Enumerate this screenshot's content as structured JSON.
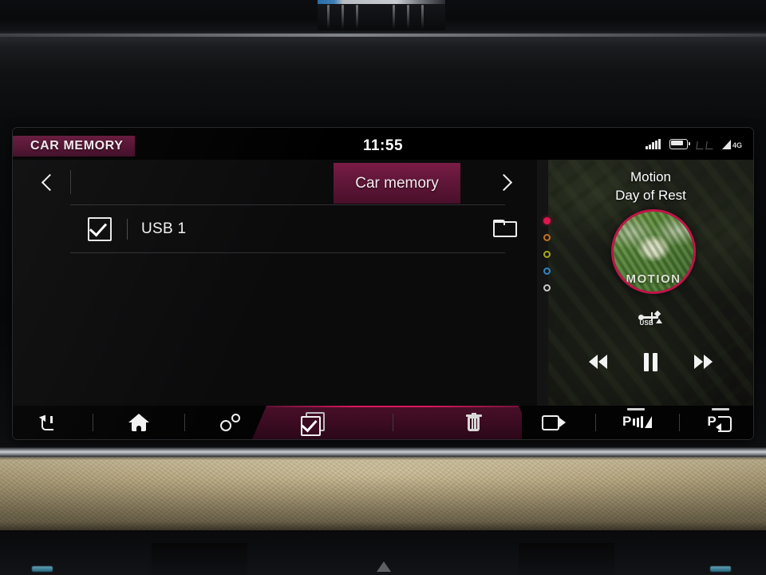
{
  "status_bar": {
    "corner_badge": "CAR MEMORY",
    "clock": "11:55",
    "icons": {
      "signal": "signal-bars-icon",
      "battery": "battery-icon",
      "seat": "seat-sensor-icon",
      "network_label": "4G"
    }
  },
  "browser": {
    "back_arrow": "chevron-left-icon",
    "forward_arrow": "chevron-right-icon",
    "active_tab": "Car memory",
    "rows": [
      {
        "label": "USB 1",
        "checked": true,
        "trailing_icon": "folder-icon"
      }
    ]
  },
  "media": {
    "artist": "Motion",
    "track": "Day of Rest",
    "album_art_word": "MOTION",
    "source_label": "USB",
    "source_icon": "usb-icon",
    "controls": {
      "rewind": "rewind-icon",
      "pause": "pause-icon",
      "forward": "fast-forward-icon"
    },
    "page_dots": [
      {
        "color": "#e0164e",
        "active": true
      },
      {
        "color": "#c9721b",
        "active": false
      },
      {
        "color": "#a8a81c",
        "active": false
      },
      {
        "color": "#2f86c4",
        "active": false
      },
      {
        "color": "#c9c9c9",
        "active": false
      }
    ]
  },
  "toolbar": {
    "left": [
      {
        "icon": "back-arrow-icon"
      },
      {
        "icon": "home-icon"
      },
      {
        "icon": "options-icon"
      }
    ],
    "center": [
      {
        "icon": "select-all-icon"
      },
      {
        "icon": "delete-trash-icon"
      }
    ],
    "right": [
      {
        "icon": "camera-icon"
      },
      {
        "icon": "parking-sensor-icon",
        "label": "P"
      },
      {
        "icon": "park-assist-icon",
        "label": "P"
      }
    ]
  },
  "colors": {
    "accent_crimson": "#d6185a",
    "badge_maroon": "#521030",
    "tab_crimson": "#63173a",
    "screen_black": "#0b0b0c",
    "leather_tan": "#b4a47e"
  }
}
